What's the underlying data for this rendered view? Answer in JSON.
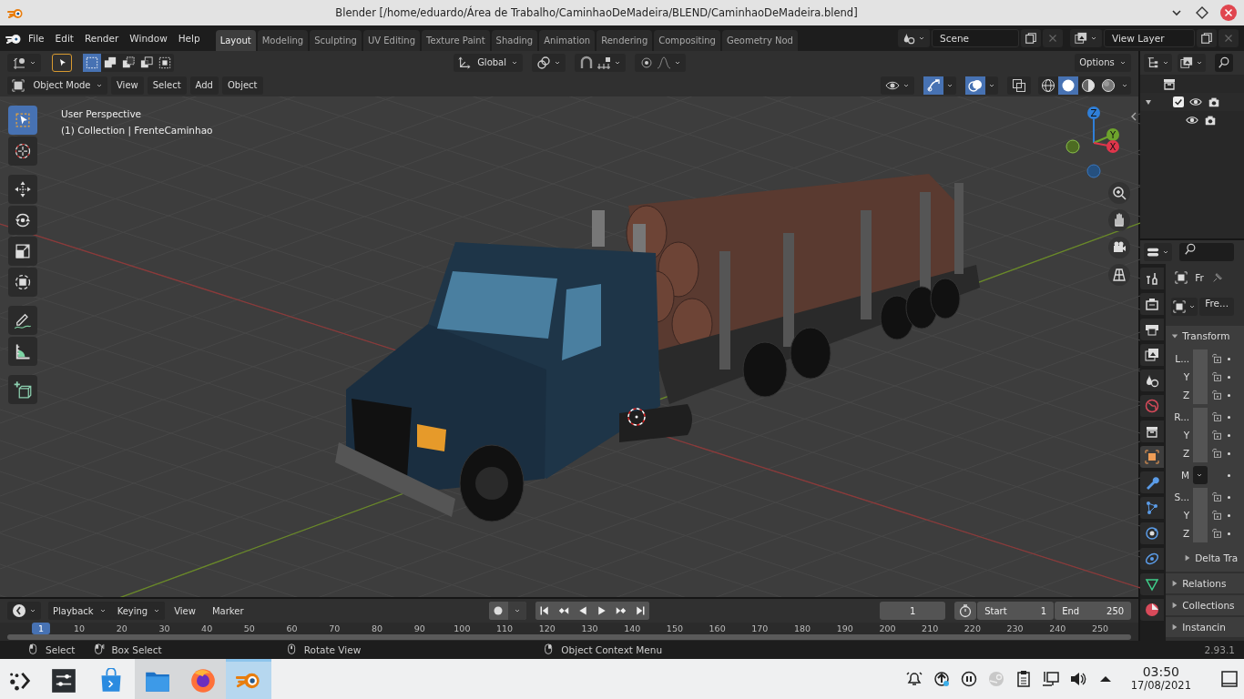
{
  "window": {
    "title": "Blender [/home/eduardo/Área de Trabalho/CaminhaoDeMadeira/BLEND/CaminhaoDeMadeira.blend]"
  },
  "menu": [
    "File",
    "Edit",
    "Render",
    "Window",
    "Help"
  ],
  "workspaces": [
    {
      "label": "Layout",
      "selected": true
    },
    {
      "label": "Modeling",
      "selected": false
    },
    {
      "label": "Sculpting",
      "selected": false
    },
    {
      "label": "UV Editing",
      "selected": false
    },
    {
      "label": "Texture Paint",
      "selected": false
    },
    {
      "label": "Shading",
      "selected": false
    },
    {
      "label": "Animation",
      "selected": false
    },
    {
      "label": "Rendering",
      "selected": false
    },
    {
      "label": "Compositing",
      "selected": false
    },
    {
      "label": "Geometry Nod",
      "selected": false
    }
  ],
  "scene": {
    "value": "Scene"
  },
  "view_layer": {
    "value": "View Layer"
  },
  "viewport": {
    "select_modes": [
      {
        "kind": "set",
        "selected": true
      },
      {
        "kind": "extend",
        "selected": false
      },
      {
        "kind": "subtract",
        "selected": false
      },
      {
        "kind": "difference",
        "selected": false
      },
      {
        "kind": "intersect",
        "selected": false
      }
    ],
    "orientation": "Global",
    "options": "Options",
    "mode": "Object Mode",
    "menus": [
      "View",
      "Select",
      "Add",
      "Object"
    ],
    "gizmos": {
      "on": true
    },
    "overlays": {
      "on": true
    },
    "xray": {
      "on": false
    },
    "shading": [
      {
        "kind": "wireframe",
        "selected": false
      },
      {
        "kind": "solid",
        "selected": true
      },
      {
        "kind": "material",
        "selected": false
      },
      {
        "kind": "rendered",
        "selected": false
      }
    ],
    "info": [
      "User Perspective",
      "(1) Collection | FrenteCaminhao"
    ],
    "tools": [
      {
        "kind": "select",
        "selected": true
      },
      {
        "kind": "cursor",
        "selected": false
      },
      {
        "kind": "move",
        "selected": false
      },
      {
        "kind": "rotate",
        "selected": false
      },
      {
        "kind": "scale",
        "selected": false
      },
      {
        "kind": "transform",
        "selected": false
      },
      {
        "kind": "annotate",
        "selected": false
      },
      {
        "kind": "measure",
        "selected": false
      },
      {
        "kind": "add_cube",
        "selected": false
      }
    ],
    "axes": [
      {
        "label": "Z",
        "color": "#2f7fd8"
      },
      {
        "label": "Y",
        "color": "#6ea32c"
      },
      {
        "label": "X",
        "color": "#e0354b"
      }
    ]
  },
  "outliner": {
    "rows": [
      {
        "kind": "scene_collection"
      },
      {
        "kind": "collection",
        "expanded": true,
        "checked": true
      },
      {
        "kind": "object"
      }
    ]
  },
  "properties": {
    "tabs": [
      {
        "kind": "tool",
        "selected": false
      },
      {
        "kind": "render",
        "selected": false
      },
      {
        "kind": "output",
        "selected": false
      },
      {
        "kind": "view_layer",
        "selected": false
      },
      {
        "kind": "scene",
        "selected": false
      },
      {
        "kind": "world",
        "selected": false
      },
      {
        "kind": "collection",
        "selected": false
      },
      {
        "kind": "object",
        "selected": true
      },
      {
        "kind": "modifiers",
        "selected": false
      },
      {
        "kind": "particles",
        "selected": false
      },
      {
        "kind": "physics",
        "selected": false
      },
      {
        "kind": "constraints",
        "selected": false
      },
      {
        "kind": "data",
        "selected": false
      },
      {
        "kind": "material",
        "selected": false
      }
    ],
    "object_name": "Fr",
    "datablock": "Fre...",
    "transform": {
      "label": "Transform",
      "expanded": true,
      "rows": [
        {
          "kind": "field",
          "label": "L..."
        },
        {
          "kind": "field",
          "label": "Y"
        },
        {
          "kind": "field",
          "label": "Z"
        },
        {
          "kind": "field",
          "label": "R..."
        },
        {
          "kind": "field",
          "label": "Y"
        },
        {
          "kind": "field",
          "label": "Z"
        },
        {
          "kind": "mode",
          "label": "M"
        },
        {
          "kind": "field",
          "label": "S..."
        },
        {
          "kind": "field",
          "label": "Y"
        },
        {
          "kind": "field",
          "label": "Z"
        }
      ],
      "subpanels": [
        {
          "label": "Delta Tra",
          "expanded": false
        }
      ]
    },
    "panels": [
      {
        "label": "Relations",
        "expanded": false
      },
      {
        "label": "Collections",
        "expanded": false
      },
      {
        "label": "Instancin",
        "expanded": false
      }
    ]
  },
  "timeline": {
    "dropdowns": [
      "Playback",
      "Keying"
    ],
    "menus": [
      "View",
      "Marker"
    ],
    "auto_key": {
      "on": false
    },
    "current_frame": "1",
    "start_label": "Start",
    "start": "1",
    "end_label": "End",
    "end": "250",
    "playhead": "1",
    "ruler": [
      "10",
      "20",
      "30",
      "40",
      "50",
      "60",
      "70",
      "80",
      "90",
      "100",
      "110",
      "120",
      "130",
      "140",
      "150",
      "160",
      "170",
      "180",
      "190",
      "200",
      "210",
      "220",
      "230",
      "240",
      "250"
    ]
  },
  "status_bar": {
    "hints": [
      "Select",
      "Box Select",
      "Rotate View",
      "Object Context Menu"
    ],
    "version": "2.93.1"
  },
  "taskbar": {
    "apps": [
      {
        "kind": "launcher",
        "open": false,
        "selected": false
      },
      {
        "kind": "settings",
        "open": false,
        "selected": false
      },
      {
        "kind": "store",
        "open": false,
        "selected": false
      },
      {
        "kind": "files",
        "open": true,
        "selected": false
      },
      {
        "kind": "browser",
        "open": true,
        "selected": false
      },
      {
        "kind": "blender",
        "open": true,
        "selected": true
      }
    ],
    "tray": [
      {
        "kind": "notifications"
      },
      {
        "kind": "updates"
      },
      {
        "kind": "media"
      },
      {
        "kind": "steam"
      },
      {
        "kind": "clipboard"
      },
      {
        "kind": "network"
      },
      {
        "kind": "volume"
      },
      {
        "kind": "expand"
      }
    ],
    "clock": {
      "time": "03:50",
      "date": "17/08/2021"
    }
  }
}
